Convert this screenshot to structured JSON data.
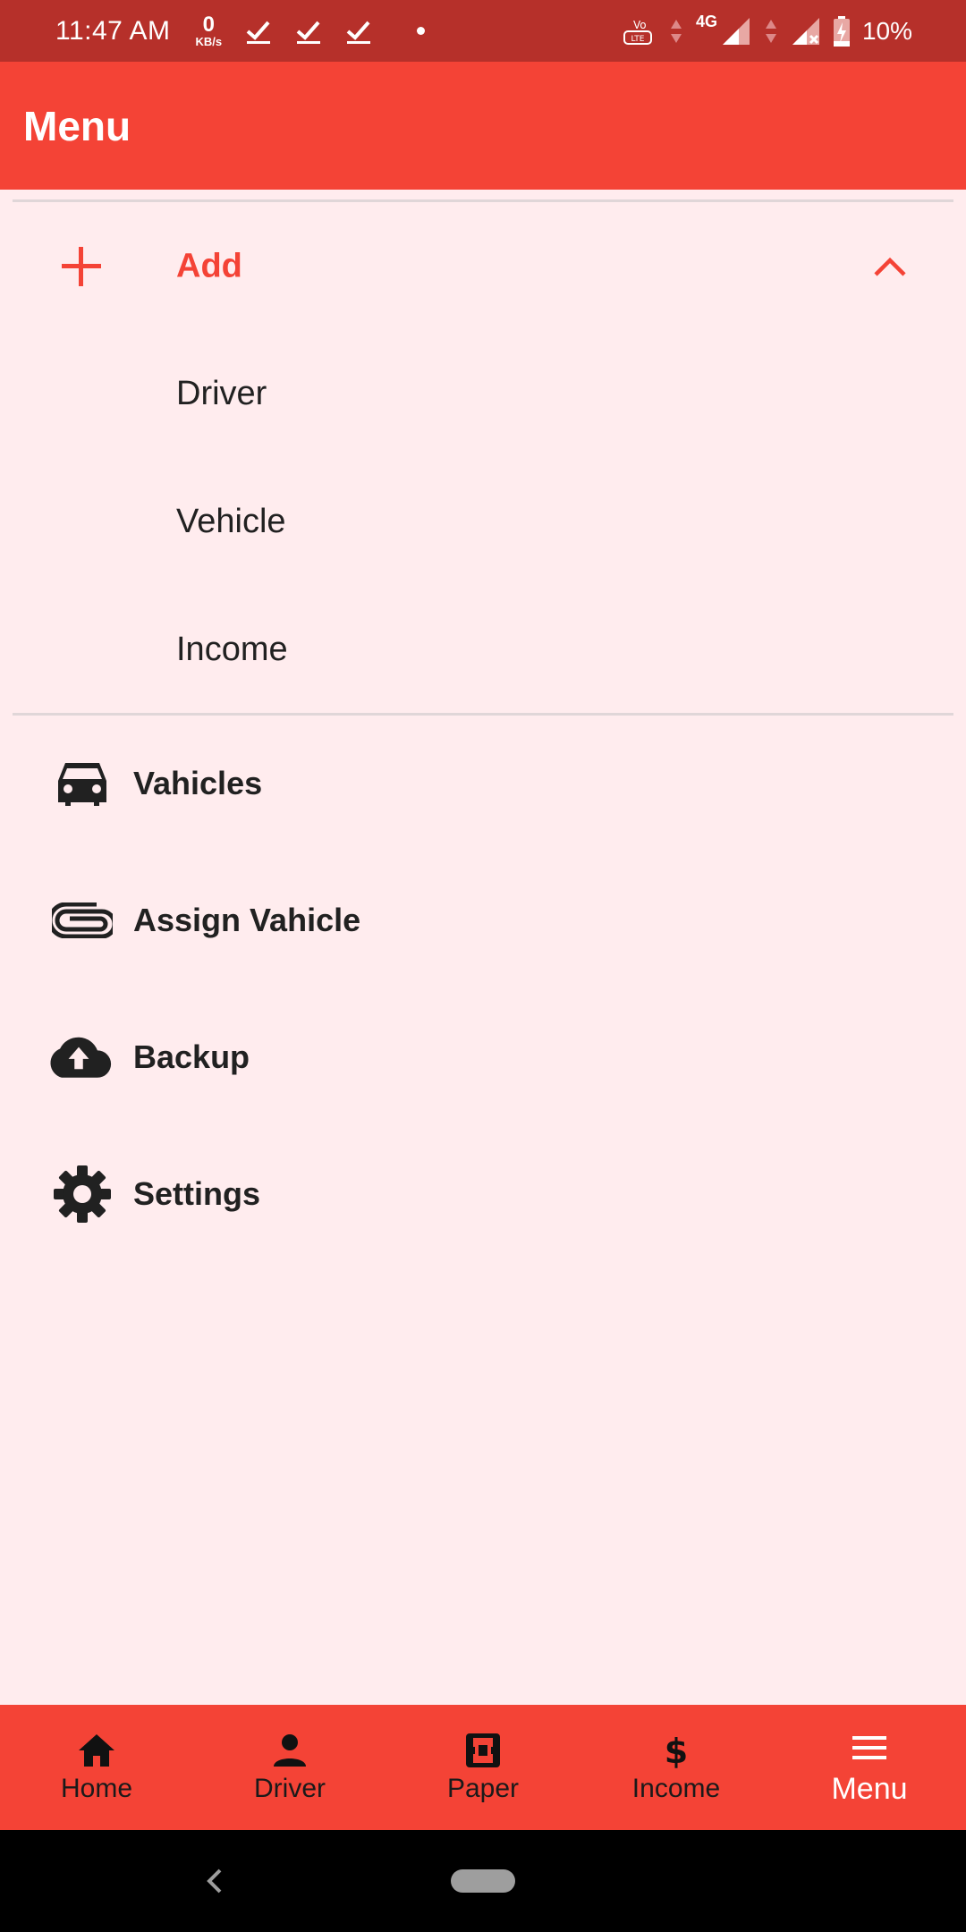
{
  "status_bar": {
    "time": "11:47 AM",
    "speed_value": "0",
    "speed_unit": "KB/s",
    "network": "4G",
    "battery": "10%"
  },
  "app_bar": {
    "title": "Menu"
  },
  "add_section": {
    "label": "Add",
    "sub_items": [
      "Driver",
      "Vehicle",
      "Income"
    ]
  },
  "menu_items": [
    {
      "label": "Vahicles",
      "icon": "car-icon"
    },
    {
      "label": "Assign Vahicle",
      "icon": "paperclip-icon"
    },
    {
      "label": "Backup",
      "icon": "cloud-upload-icon"
    },
    {
      "label": "Settings",
      "icon": "gear-icon"
    }
  ],
  "bottom_nav": [
    {
      "label": "Home",
      "icon": "home-icon"
    },
    {
      "label": "Driver",
      "icon": "person-icon"
    },
    {
      "label": "Paper",
      "icon": "paper-icon"
    },
    {
      "label": "Income",
      "icon": "dollar-icon"
    },
    {
      "label": "Menu",
      "icon": "menu-icon",
      "active": true
    }
  ],
  "colors": {
    "primary": "#f44336",
    "status_bar": "#b6302a",
    "background": "#ffecee"
  }
}
